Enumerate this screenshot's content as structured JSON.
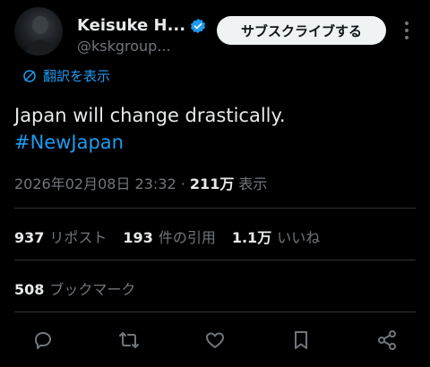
{
  "user": {
    "display_name": "Keisuke H...",
    "handle": "@kskgroup...",
    "verified": true,
    "subscribe_label": "サブスクライブする"
  },
  "translate_label": "翻訳を表示",
  "tweet": {
    "text": "Japan will change drastically.",
    "hashtag": "#NewJapan"
  },
  "meta": {
    "datetime": "2026年02月08日 23:32",
    "separator": "·",
    "views_count": "211万",
    "views_label": "表示"
  },
  "stats": {
    "reposts_count": "937",
    "reposts_label": "リポスト",
    "quotes_count": "193",
    "quotes_label": "件の引用",
    "likes_count": "1.1万",
    "likes_label": "いいね",
    "bookmarks_count": "508",
    "bookmarks_label": "ブックマーク"
  },
  "colors": {
    "background": "#000000",
    "text": "#e7e9ea",
    "muted": "#71767b",
    "accent": "#1d9bf0",
    "divider": "#2f3336"
  },
  "icons": [
    "verified-badge-icon",
    "more-options-icon",
    "translate-icon",
    "reply-icon",
    "repost-icon",
    "like-icon",
    "bookmark-icon",
    "share-icon"
  ]
}
